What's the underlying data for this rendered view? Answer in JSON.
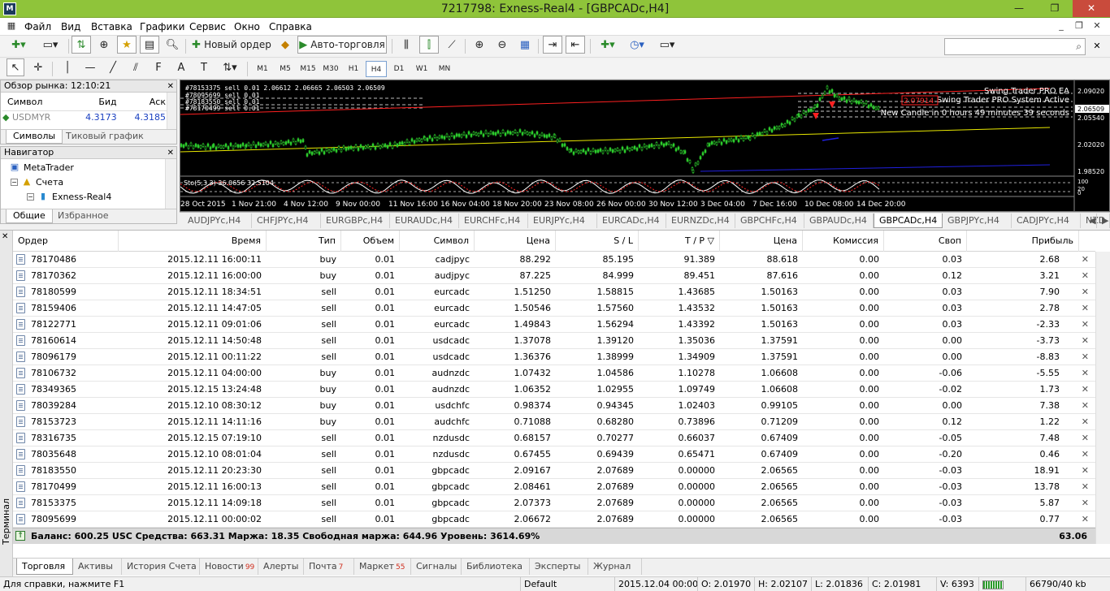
{
  "window": {
    "title": "7217798: Exness-Real4 - [GBPCADc,H4]",
    "min": "—",
    "max": "❐",
    "close": "✕"
  },
  "menu": [
    "Файл",
    "Вид",
    "Вставка",
    "Графики",
    "Сервис",
    "Окно",
    "Справка"
  ],
  "toolbar": {
    "new_order": "Новый ордер",
    "autotrading": "Авто-торговля"
  },
  "timeframes": [
    "M1",
    "M5",
    "M15",
    "M30",
    "H1",
    "H4",
    "D1",
    "W1",
    "MN"
  ],
  "active_timeframe": "H4",
  "market_watch": {
    "title": "Обзор рынка: 12:10:21",
    "col_symbol": "Символ",
    "col_bid": "Бид",
    "col_ask": "Аск",
    "row": {
      "symbol": "USDMYR",
      "bid": "4.3173",
      "ask": "4.3185"
    },
    "tabs": [
      "Символы",
      "Тиковый график"
    ]
  },
  "navigator": {
    "title": "Навигатор",
    "items": [
      "MetaTrader",
      "Счета",
      "Exness-Real4"
    ],
    "tabs": [
      "Общие",
      "Избранное"
    ]
  },
  "chart": {
    "ind_name": "Swing Trader PRO EA",
    "ind_status": "Swing Trader PRO System Active",
    "ind_candle": "New Candle in 0 hours 49 minutes 39 seconds",
    "line_label": "2.07914",
    "price_labels": [
      "2.09020",
      "2.06509",
      "2.05540",
      "2.02020",
      "1.98520"
    ],
    "sub_label": "Sto(5,3,3) 36.0656 32.5104",
    "sub_scale": [
      "100",
      "20",
      "0"
    ],
    "header_line": "#78153375 sell 0.01 2.06612 2.06665 2.06503 2.06509",
    "order_labels": [
      "#78095699 sell 0.01",
      "#78183550 sell 0.01",
      "#78170499 sell 0.01"
    ],
    "date_labels": [
      "28 Oct 2015",
      "1 Nov 21:00",
      "4 Nov 12:00",
      "9 Nov 00:00",
      "11 Nov 16:00",
      "16 Nov 04:00",
      "18 Nov 20:00",
      "23 Nov 08:00",
      "26 Nov 00:00",
      "30 Nov 12:00",
      "3 Dec 04:00",
      "7 Dec 16:00",
      "10 Dec 08:00",
      "14 Dec 20:00"
    ],
    "colors": {
      "up": "#2ccb2c",
      "redline": "#ff2020",
      "yellow": "#e8e800",
      "blue": "#2020e0"
    }
  },
  "chart_tabs": [
    "AUDJPYc,H4",
    "CHFJPYc,H4",
    "EURGBPc,H4",
    "EURAUDc,H4",
    "EURCHFc,H4",
    "EURJPYc,H4",
    "EURCADc,H4",
    "EURNZDc,H4",
    "GBPCHFc,H4",
    "GBPAUDc,H4",
    "GBPCADc,H4",
    "GBPJPYc,H4",
    "CADJPYc,H4",
    "NZD"
  ],
  "active_chart_tab": "GBPCADc,H4",
  "terminal": {
    "side_label": "Терминал",
    "headers": [
      "Ордер",
      "Время",
      "Тип",
      "Объем",
      "Символ",
      "Цена",
      "S / L",
      "T / P ▽",
      "Цена",
      "Комиссия",
      "Своп",
      "Прибыль"
    ],
    "rows": [
      [
        "78170486",
        "2015.12.11 16:00:11",
        "buy",
        "0.01",
        "cadjpyc",
        "88.292",
        "85.195",
        "91.389",
        "88.618",
        "0.00",
        "0.03",
        "2.68"
      ],
      [
        "78170362",
        "2015.12.11 16:00:00",
        "buy",
        "0.01",
        "audjpyc",
        "87.225",
        "84.999",
        "89.451",
        "87.616",
        "0.00",
        "0.12",
        "3.21"
      ],
      [
        "78180599",
        "2015.12.11 18:34:51",
        "sell",
        "0.01",
        "eurcadc",
        "1.51250",
        "1.58815",
        "1.43685",
        "1.50163",
        "0.00",
        "0.03",
        "7.90"
      ],
      [
        "78159406",
        "2015.12.11 14:47:05",
        "sell",
        "0.01",
        "eurcadc",
        "1.50546",
        "1.57560",
        "1.43532",
        "1.50163",
        "0.00",
        "0.03",
        "2.78"
      ],
      [
        "78122771",
        "2015.12.11 09:01:06",
        "sell",
        "0.01",
        "eurcadc",
        "1.49843",
        "1.56294",
        "1.43392",
        "1.50163",
        "0.00",
        "0.03",
        "-2.33"
      ],
      [
        "78160614",
        "2015.12.11 14:50:48",
        "sell",
        "0.01",
        "usdcadc",
        "1.37078",
        "1.39120",
        "1.35036",
        "1.37591",
        "0.00",
        "0.00",
        "-3.73"
      ],
      [
        "78096179",
        "2015.12.11 00:11:22",
        "sell",
        "0.01",
        "usdcadc",
        "1.36376",
        "1.38999",
        "1.34909",
        "1.37591",
        "0.00",
        "0.00",
        "-8.83"
      ],
      [
        "78106732",
        "2015.12.11 04:00:00",
        "buy",
        "0.01",
        "audnzdc",
        "1.07432",
        "1.04586",
        "1.10278",
        "1.06608",
        "0.00",
        "-0.06",
        "-5.55"
      ],
      [
        "78349365",
        "2015.12.15 13:24:48",
        "buy",
        "0.01",
        "audnzdc",
        "1.06352",
        "1.02955",
        "1.09749",
        "1.06608",
        "0.00",
        "-0.02",
        "1.73"
      ],
      [
        "78039284",
        "2015.12.10 08:30:12",
        "buy",
        "0.01",
        "usdchfc",
        "0.98374",
        "0.94345",
        "1.02403",
        "0.99105",
        "0.00",
        "0.00",
        "7.38"
      ],
      [
        "78153723",
        "2015.12.11 14:11:16",
        "buy",
        "0.01",
        "audchfc",
        "0.71088",
        "0.68280",
        "0.73896",
        "0.71209",
        "0.00",
        "0.12",
        "1.22"
      ],
      [
        "78316735",
        "2015.12.15 07:19:10",
        "sell",
        "0.01",
        "nzdusdc",
        "0.68157",
        "0.70277",
        "0.66037",
        "0.67409",
        "0.00",
        "-0.05",
        "7.48"
      ],
      [
        "78035648",
        "2015.12.10 08:01:04",
        "sell",
        "0.01",
        "nzdusdc",
        "0.67455",
        "0.69439",
        "0.65471",
        "0.67409",
        "0.00",
        "-0.20",
        "0.46"
      ],
      [
        "78183550",
        "2015.12.11 20:23:30",
        "sell",
        "0.01",
        "gbpcadc",
        "2.09167",
        "2.07689",
        "0.00000",
        "2.06565",
        "0.00",
        "-0.03",
        "18.91"
      ],
      [
        "78170499",
        "2015.12.11 16:00:13",
        "sell",
        "0.01",
        "gbpcadc",
        "2.08461",
        "2.07689",
        "0.00000",
        "2.06565",
        "0.00",
        "-0.03",
        "13.78"
      ],
      [
        "78153375",
        "2015.12.11 14:09:18",
        "sell",
        "0.01",
        "gbpcadc",
        "2.07373",
        "2.07689",
        "0.00000",
        "2.06565",
        "0.00",
        "-0.03",
        "5.87"
      ],
      [
        "78095699",
        "2015.12.11 00:00:02",
        "sell",
        "0.01",
        "gbpcadc",
        "2.06672",
        "2.07689",
        "0.00000",
        "2.06565",
        "0.00",
        "-0.03",
        "0.77"
      ]
    ],
    "summary": "Баланс: 600.25 USC  Средства: 663.31  Маржа: 18.35  Свободная маржа: 644.96  Уровень: 3614.69%",
    "summary_profit": "63.06",
    "tabs": [
      {
        "label": "Торговля",
        "badge": ""
      },
      {
        "label": "Активы",
        "badge": ""
      },
      {
        "label": "История Счета",
        "badge": ""
      },
      {
        "label": "Новости",
        "badge": "99"
      },
      {
        "label": "Алерты",
        "badge": ""
      },
      {
        "label": "Почта",
        "badge": "7"
      },
      {
        "label": "Маркет",
        "badge": "55"
      },
      {
        "label": "Сигналы",
        "badge": ""
      },
      {
        "label": "Библиотека",
        "badge": ""
      },
      {
        "label": "Эксперты",
        "badge": ""
      },
      {
        "label": "Журнал",
        "badge": ""
      }
    ]
  },
  "status": {
    "help": "Для справки, нажмите F1",
    "profile": "Default",
    "time": "2015.12.04 00:00",
    "open": "O: 2.01970",
    "high": "H: 2.02107",
    "low": "L: 2.01836",
    "close": "C: 2.01981",
    "volume": "V: 6393",
    "traffic": "66790/40 kb"
  }
}
